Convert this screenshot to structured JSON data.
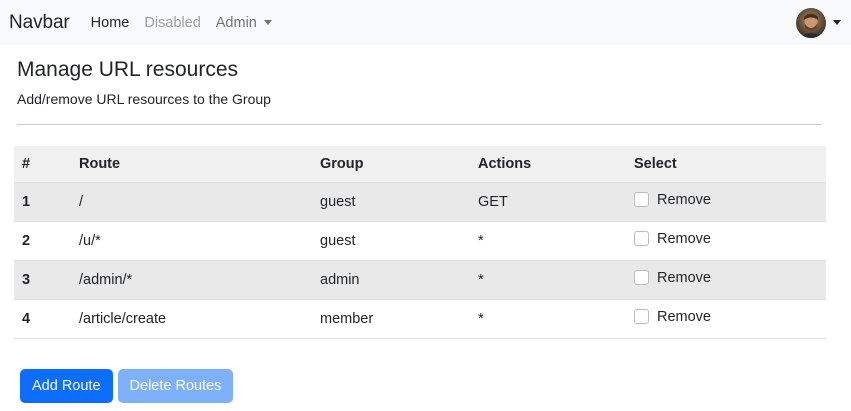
{
  "navbar": {
    "brand": "Navbar",
    "links": [
      {
        "label": "Home"
      },
      {
        "label": "Disabled"
      },
      {
        "label": "Admin"
      }
    ]
  },
  "page": {
    "title": "Manage URL resources",
    "subtitle": "Add/remove URL resources to the Group"
  },
  "table": {
    "headers": [
      "#",
      "Route",
      "Group",
      "Actions",
      "Select"
    ],
    "rows": [
      {
        "num": "1",
        "route": "/",
        "group": "guest",
        "actions": "GET",
        "select_label": "Remove"
      },
      {
        "num": "2",
        "route": "/u/*",
        "group": "guest",
        "actions": "*",
        "select_label": "Remove"
      },
      {
        "num": "3",
        "route": "/admin/*",
        "group": "admin",
        "actions": "*",
        "select_label": "Remove"
      },
      {
        "num": "4",
        "route": "/article/create",
        "group": "member",
        "actions": "*",
        "select_label": "Remove"
      }
    ]
  },
  "buttons": {
    "add_label": "Add Route",
    "delete_label": "Delete Routes"
  },
  "colors": {
    "primary": "#0d6efd",
    "primary_disabled": "#7fb0fc",
    "navbar_bg": "#f8f9fa"
  }
}
